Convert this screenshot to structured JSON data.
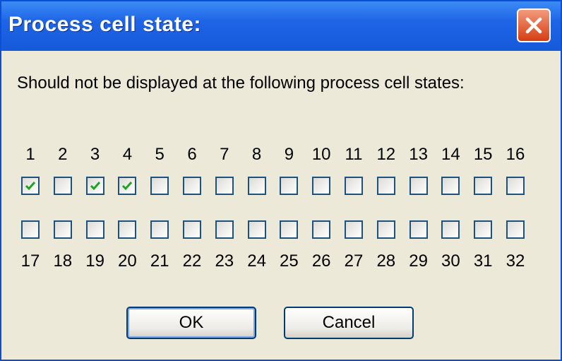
{
  "window": {
    "title": "Process cell state:"
  },
  "instruction": "Should not be displayed at the following process cell states:",
  "states_row1": [
    {
      "label": "1",
      "checked": true
    },
    {
      "label": "2",
      "checked": false
    },
    {
      "label": "3",
      "checked": true
    },
    {
      "label": "4",
      "checked": true
    },
    {
      "label": "5",
      "checked": false
    },
    {
      "label": "6",
      "checked": false
    },
    {
      "label": "7",
      "checked": false
    },
    {
      "label": "8",
      "checked": false
    },
    {
      "label": "9",
      "checked": false
    },
    {
      "label": "10",
      "checked": false
    },
    {
      "label": "11",
      "checked": false
    },
    {
      "label": "12",
      "checked": false
    },
    {
      "label": "13",
      "checked": false
    },
    {
      "label": "14",
      "checked": false
    },
    {
      "label": "15",
      "checked": false
    },
    {
      "label": "16",
      "checked": false
    }
  ],
  "states_row2": [
    {
      "label": "17",
      "checked": false
    },
    {
      "label": "18",
      "checked": false
    },
    {
      "label": "19",
      "checked": false
    },
    {
      "label": "20",
      "checked": false
    },
    {
      "label": "21",
      "checked": false
    },
    {
      "label": "22",
      "checked": false
    },
    {
      "label": "23",
      "checked": false
    },
    {
      "label": "24",
      "checked": false
    },
    {
      "label": "25",
      "checked": false
    },
    {
      "label": "26",
      "checked": false
    },
    {
      "label": "27",
      "checked": false
    },
    {
      "label": "28",
      "checked": false
    },
    {
      "label": "29",
      "checked": false
    },
    {
      "label": "30",
      "checked": false
    },
    {
      "label": "31",
      "checked": false
    },
    {
      "label": "32",
      "checked": false
    }
  ],
  "buttons": {
    "ok": "OK",
    "cancel": "Cancel"
  },
  "colors": {
    "title_bar": "#1e64e6",
    "dialog_bg": "#ece9d8",
    "check_mark": "#21a121",
    "close_button": "#d63d12"
  },
  "icons": {
    "close": "close-icon",
    "check": "check-icon"
  }
}
